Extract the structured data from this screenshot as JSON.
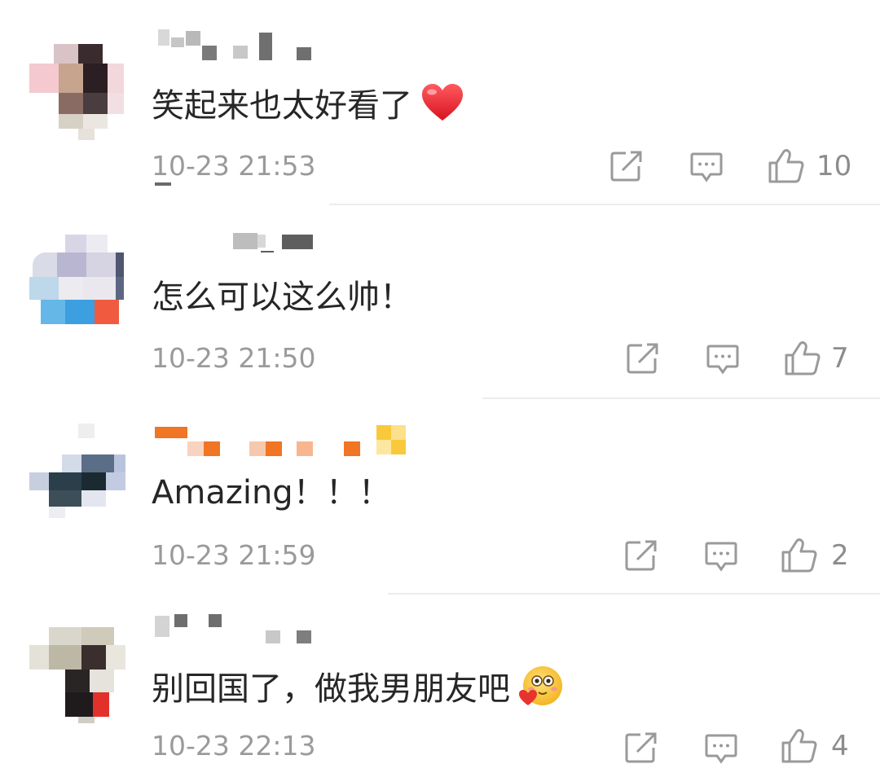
{
  "comments": [
    {
      "text": "笑起来也太好看了",
      "emoji": "heart-emoji",
      "time": "10-23 21:53",
      "likes": "10"
    },
    {
      "text": "怎么可以这么帅！",
      "emoji": "",
      "time": "10-23 21:50",
      "likes": "7"
    },
    {
      "text": "Amazing！！！",
      "emoji": "",
      "time": "10-23 21:59",
      "likes": "2"
    },
    {
      "text": "别回国了，做我男朋友吧",
      "emoji": "in-love-face-emoji",
      "time": "10-23 22:13",
      "likes": "4"
    }
  ],
  "icons": {
    "repost": "share-square-arrow-icon",
    "reply": "comment-bubble-icon",
    "like": "thumbs-up-icon"
  },
  "colors": {
    "text": "#262626",
    "meta": "#9a9a9a",
    "heart": "#e0202c",
    "mosaic_orange": "#f07524",
    "mosaic_yellow": "#f8c93a"
  }
}
